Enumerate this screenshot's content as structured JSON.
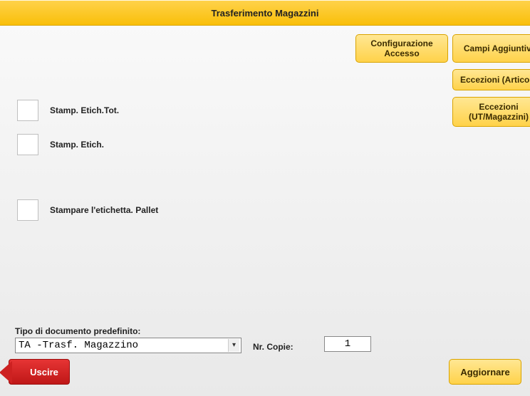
{
  "title": "Trasferimento Magazzini",
  "top_buttons": {
    "config_access": "Configurazione Accesso",
    "extra_fields": "Campi Aggiuntivi",
    "exc_articles": "Eccezioni (Articoli)",
    "exc_utmag": "Eccezioni (UT/Magazzini)"
  },
  "checkboxes": {
    "stamp_tot": "Stamp. Etich.Tot.",
    "stamp_etich": "Stamp. Etich.",
    "stamp_pallet": "Stampare l'etichetta. Pallet"
  },
  "form": {
    "doc_type_label": "Tipo di documento predefinito:",
    "doc_type_value": "TA -Trasf. Magazzino",
    "copies_label": "Nr. Copie:",
    "copies_value": "1"
  },
  "bottom_buttons": {
    "exit": "Uscire",
    "update": "Aggiornare"
  }
}
